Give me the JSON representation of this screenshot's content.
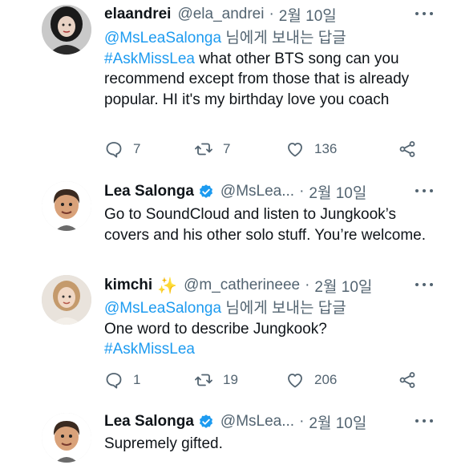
{
  "tweets": [
    {
      "name": "elaandrei",
      "handle": "@ela_andrei",
      "date": "2월 10일",
      "reply_mention": "@MsLeaSalonga",
      "reply_suffix": " 님에게 보내는 답글",
      "hashtag": "#AskMissLea",
      "text": " what other BTS song can you recommend except from those that is already popular. HI it's my birthday love you coach",
      "replies": "7",
      "retweets": "7",
      "likes": "136"
    },
    {
      "name": "Lea Salonga",
      "handle": "@MsLea...",
      "date": "2월 10일",
      "text": "Go to SoundCloud and listen to Jungkook’s covers and his other solo stuff. You’re welcome."
    },
    {
      "name": "kimchi",
      "handle": "@m_catherineee",
      "date": "2월 10일",
      "reply_mention": "@MsLeaSalonga",
      "reply_suffix": " 님에게 보내는 답글",
      "text": "One word to describe Jungkook?",
      "hashtag": "#AskMissLea",
      "replies": "1",
      "retweets": "19",
      "likes": "206"
    },
    {
      "name": "Lea Salonga",
      "handle": "@MsLea...",
      "date": "2월 10일",
      "text": "Supremely gifted."
    }
  ],
  "colors": {
    "link": "#1d9bf0",
    "muted": "#536471",
    "verified": "#1d9bf0"
  },
  "icons": [
    "reply-icon",
    "retweet-icon",
    "like-icon",
    "share-icon",
    "more-icon",
    "verified-badge-icon",
    "sparkle-icon"
  ]
}
